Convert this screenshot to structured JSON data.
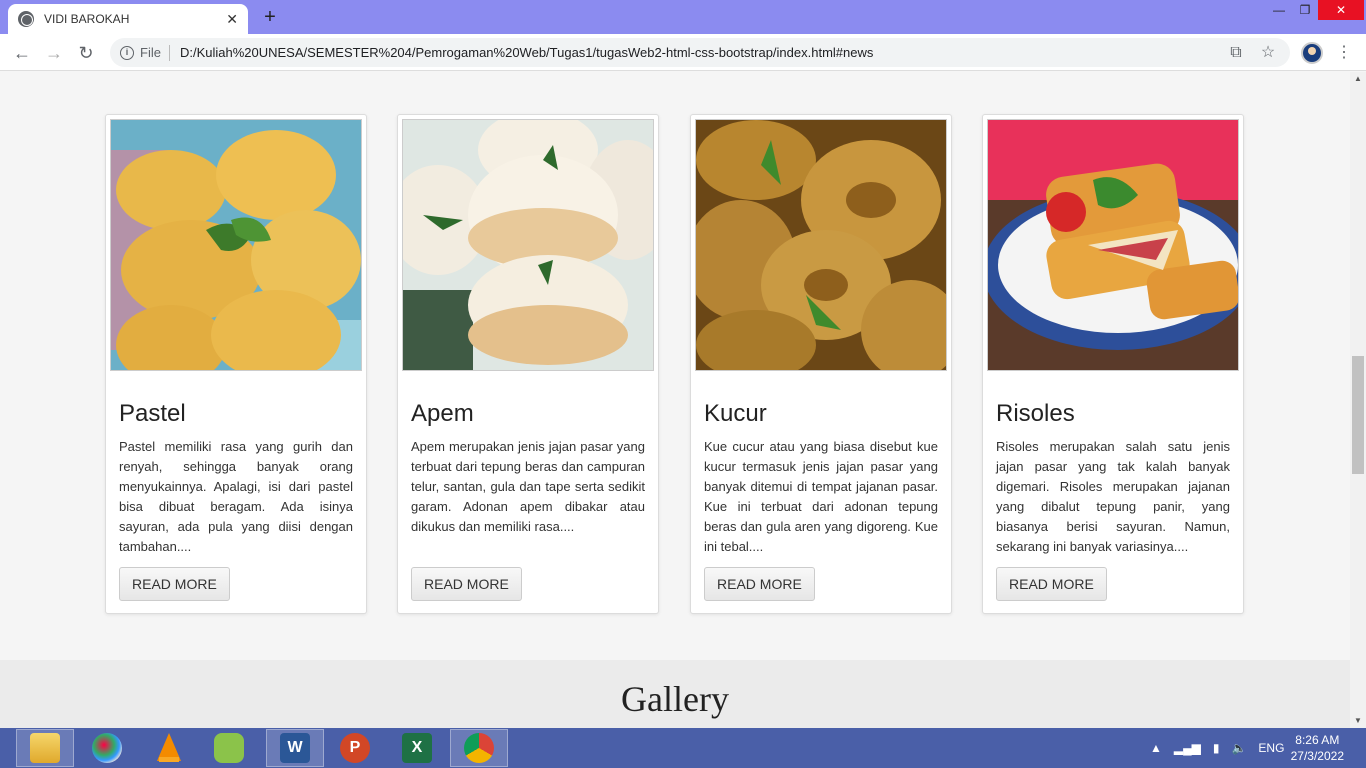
{
  "browser": {
    "tab_title": "VIDI BAROKAH",
    "tab_close": "✕",
    "new_tab": "+",
    "win_min": "—",
    "win_max": "❐",
    "win_close": "✕",
    "back": "←",
    "forward": "→",
    "reload": "↻",
    "file_label": "File",
    "url": "D:/Kuliah%20UNESA/SEMESTER%204/Pemrogaman%20Web/Tugas1/tugasWeb2-html-css-bootstrap/index.html#news",
    "menu": "⋮"
  },
  "cards": [
    {
      "title": "Pastel",
      "text": "Pastel memiliki rasa yang gurih dan renyah, sehingga banyak orang menyukainnya. Apalagi, isi dari pastel bisa dibuat beragam. Ada isinya sayuran, ada pula yang diisi dengan tambahan....",
      "button": "READ MORE"
    },
    {
      "title": "Apem",
      "text": "Apem merupakan jenis jajan pasar yang terbuat dari tepung beras dan campuran telur, santan, gula dan tape serta sedikit garam. Adonan apem dibakar atau dikukus dan memiliki rasa....",
      "button": "READ MORE"
    },
    {
      "title": "Kucur",
      "text": "Kue cucur atau yang biasa disebut kue kucur termasuk jenis jajan pasar yang banyak ditemui di tempat jajanan pasar. Kue ini terbuat dari adonan tepung beras dan gula aren yang digoreng. Kue ini tebal....",
      "button": "READ MORE"
    },
    {
      "title": "Risoles",
      "text": "Risoles merupakan salah satu jenis jajan pasar yang tak kalah banyak digemari. Risoles merupakan jajanan yang dibalut tepung panir, yang biasanya berisi sayuran. Namun, sekarang ini banyak variasinya....",
      "button": "READ MORE"
    }
  ],
  "gallery": {
    "title": "Gallery"
  },
  "taskbar": {
    "apps": [
      "file-explorer",
      "paint",
      "vlc",
      "app-green",
      "word",
      "powerpoint",
      "excel",
      "chrome"
    ],
    "lang": "ENG",
    "time": "8:26 AM",
    "date": "27/3/2022"
  }
}
